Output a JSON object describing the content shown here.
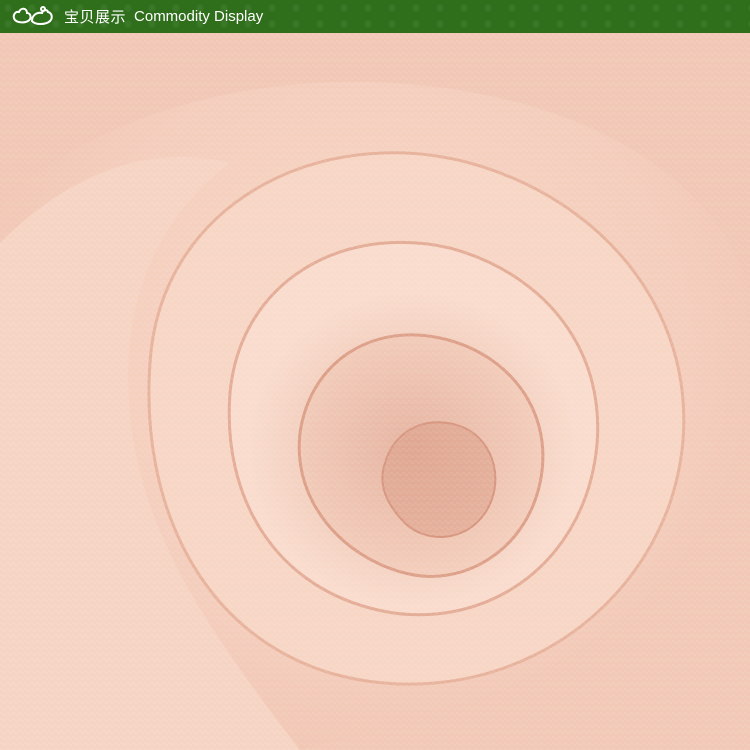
{
  "banner": {
    "title_cn": "宝贝展示",
    "title_en": "Commodity Display",
    "logo_icon": "teapot-flower-icon",
    "background_color": "#2f6f1c"
  },
  "photo": {
    "subject": "rolled-fabric",
    "dominant_color": "#f6d3c4"
  }
}
